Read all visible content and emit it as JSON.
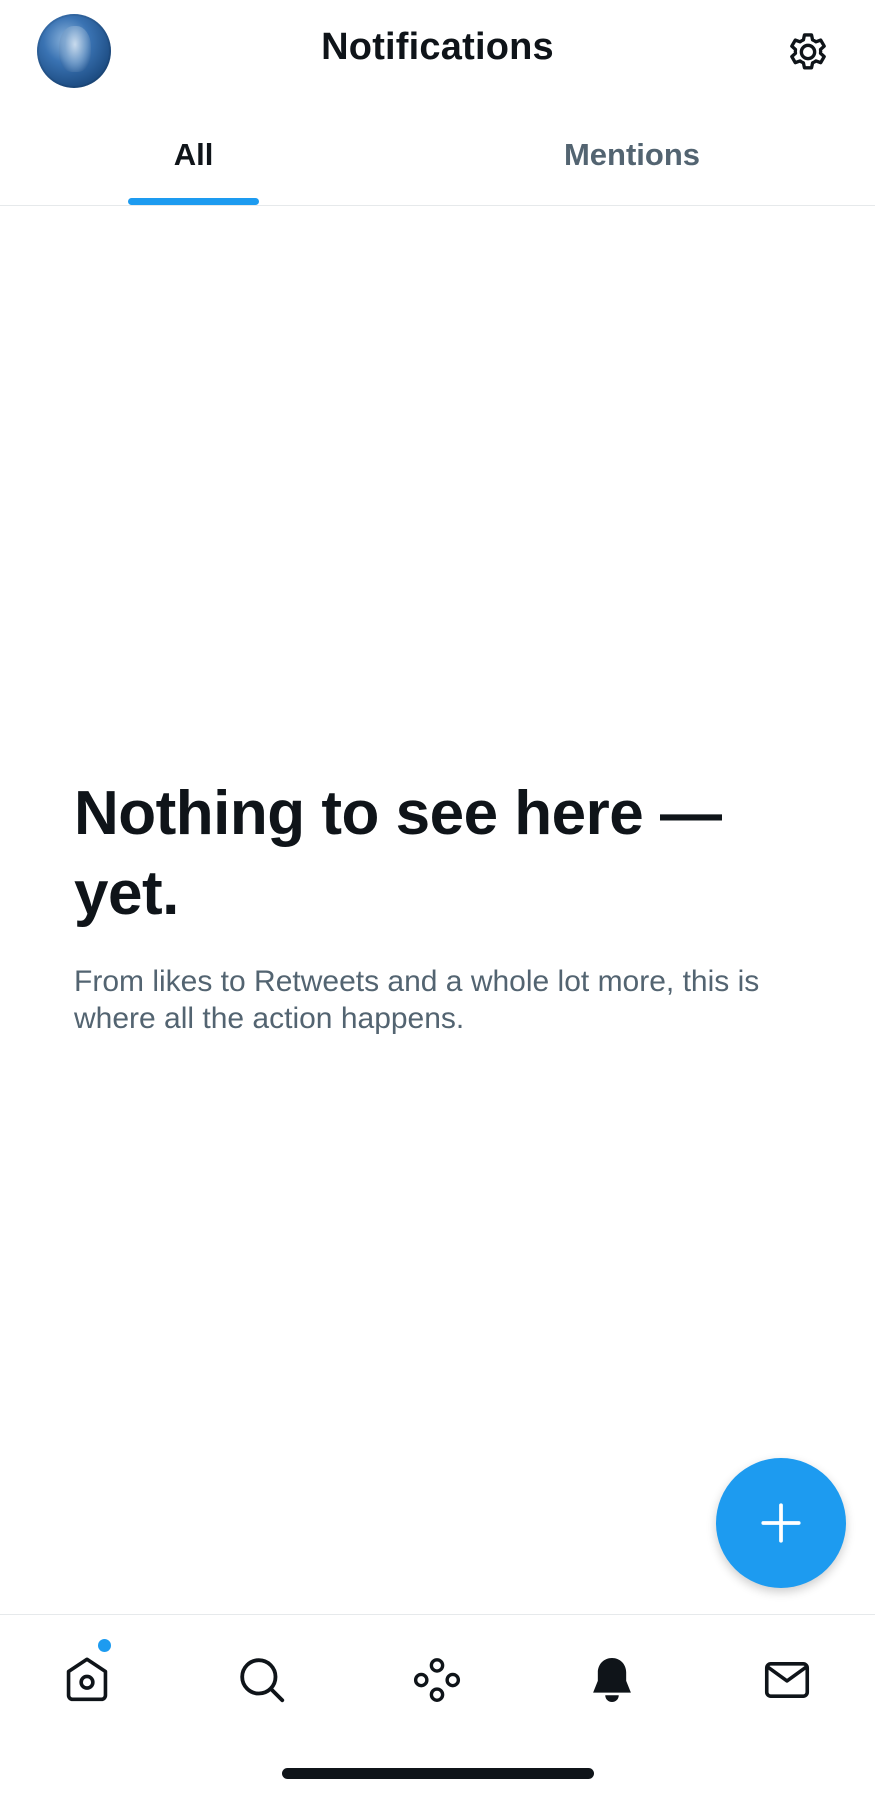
{
  "header": {
    "title": "Notifications",
    "avatar_icon": "profile-avatar",
    "settings_icon": "gear-icon"
  },
  "tabs": [
    {
      "label": "All",
      "active": true
    },
    {
      "label": "Mentions",
      "active": false
    }
  ],
  "empty_state": {
    "heading": "Nothing to see here — yet.",
    "body": "From likes to Retweets and a whole lot more, this is where all the action happens."
  },
  "fab": {
    "icon": "plus-icon"
  },
  "bottom_nav": {
    "items": [
      {
        "name": "home",
        "icon": "home-icon",
        "has_notification_dot": true
      },
      {
        "name": "search",
        "icon": "search-icon"
      },
      {
        "name": "spaces",
        "icon": "spaces-icon"
      },
      {
        "name": "notifications",
        "icon": "bell-icon",
        "active": true
      },
      {
        "name": "messages",
        "icon": "mail-icon"
      }
    ]
  },
  "colors": {
    "accent": "#1d9bf0",
    "text_primary": "#0f1419",
    "text_secondary": "#536471",
    "divider": "#e6e9eb"
  }
}
